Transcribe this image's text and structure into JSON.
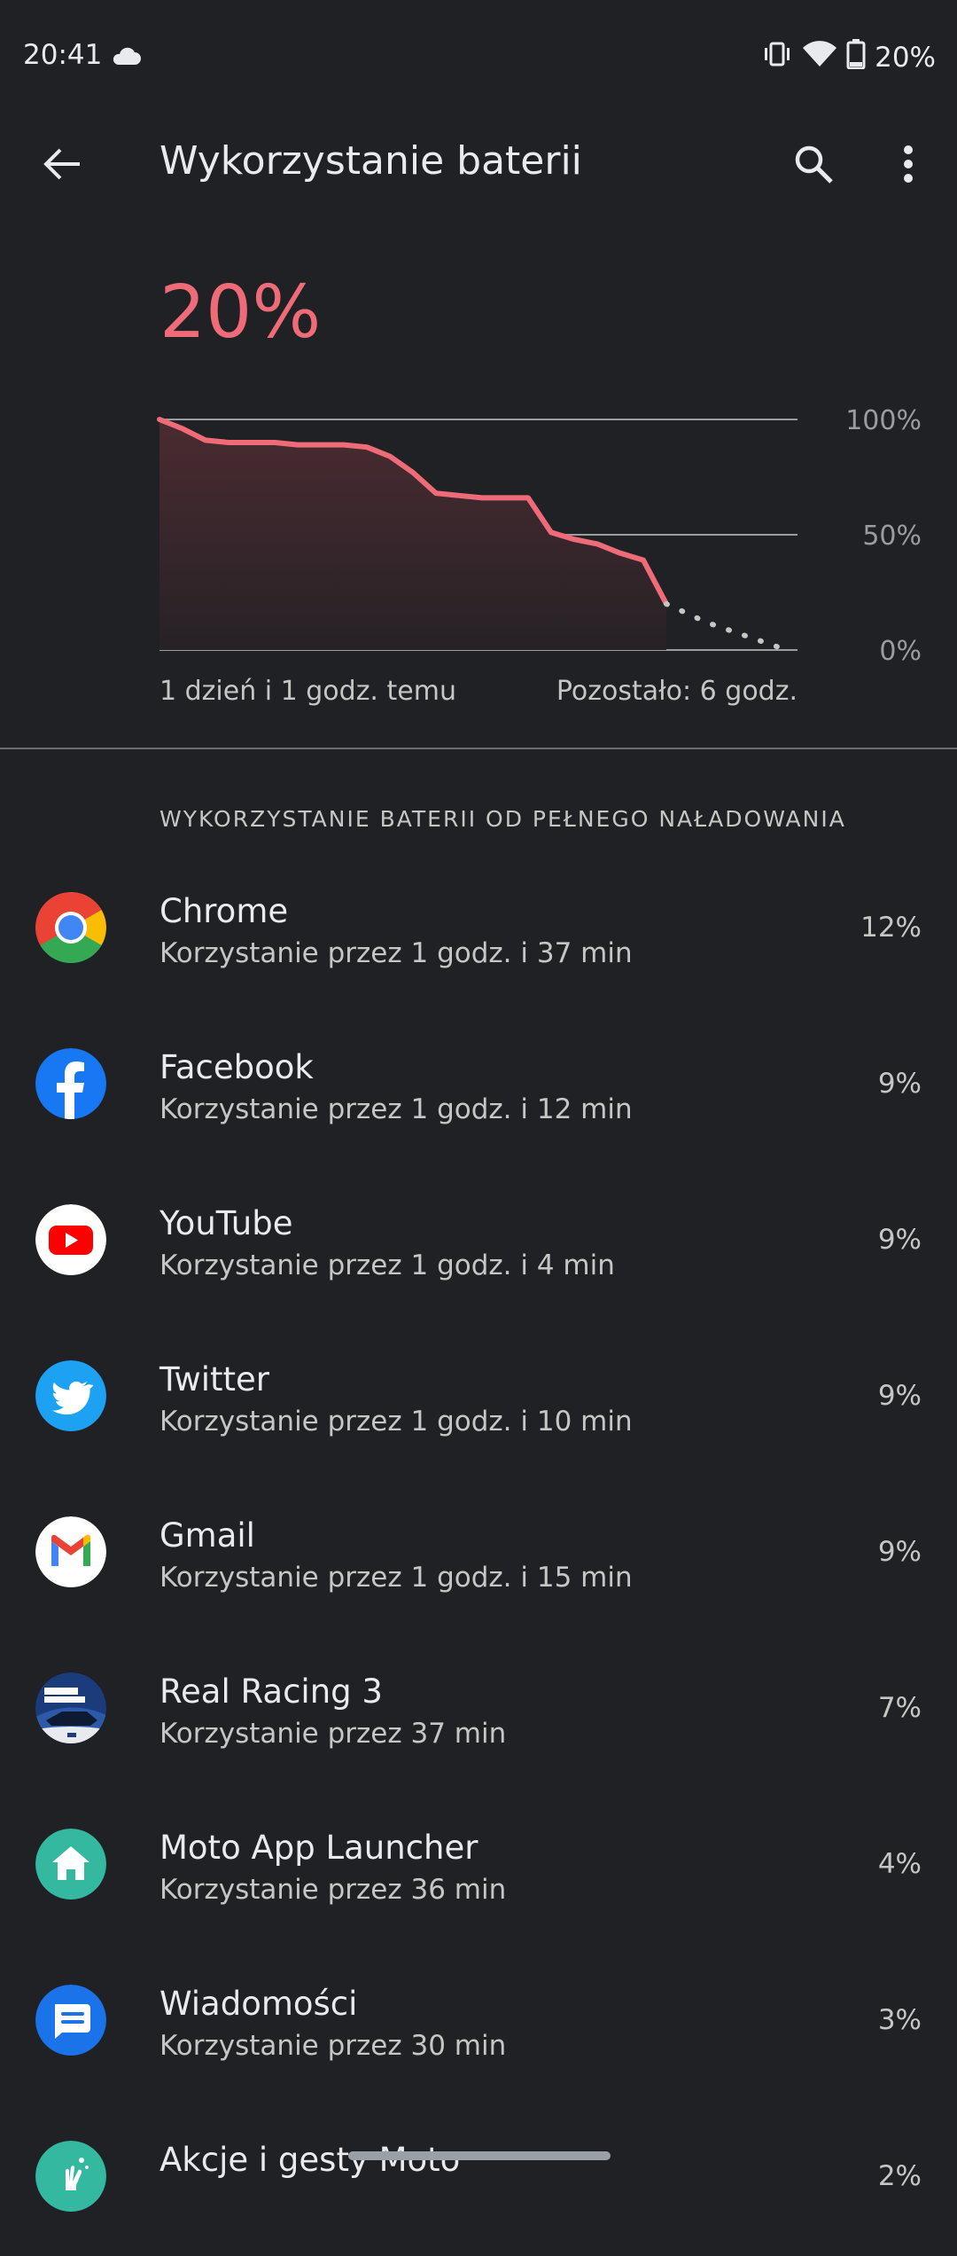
{
  "status_bar": {
    "time": "20:41",
    "battery_pct": "20%"
  },
  "app_bar": {
    "title": "Wykorzystanie baterii"
  },
  "summary": {
    "current_pct": "20%",
    "chart_left_label": "1 dzień i 1 godz. temu",
    "chart_right_label": "Pozostało: 6 godz.",
    "chart_accent": "#f06b78"
  },
  "chart_data": {
    "type": "area",
    "y_ticks": [
      "100%",
      "50%",
      "0%"
    ],
    "ylim": [
      0,
      100
    ],
    "history": [
      100,
      96,
      91,
      90,
      90,
      90,
      89,
      89,
      89,
      88,
      84,
      77,
      68,
      67,
      66,
      66,
      66,
      51,
      48,
      46,
      42,
      39,
      20
    ],
    "projection": [
      20,
      12,
      6,
      0
    ]
  },
  "section": {
    "title": "WYKORZYSTANIE BATERII OD PEŁNEGO NAŁADOWANIA"
  },
  "apps": [
    {
      "name": "Chrome",
      "usage": "Korzystanie przez 1 godz. i 37 min",
      "pct": "12%",
      "icon": "chrome-icon"
    },
    {
      "name": "Facebook",
      "usage": "Korzystanie przez 1 godz. i 12 min",
      "pct": "9%",
      "icon": "facebook-icon"
    },
    {
      "name": "YouTube",
      "usage": "Korzystanie przez 1 godz. i 4 min",
      "pct": "9%",
      "icon": "youtube-icon"
    },
    {
      "name": "Twitter",
      "usage": "Korzystanie przez 1 godz. i 10 min",
      "pct": "9%",
      "icon": "twitter-icon"
    },
    {
      "name": "Gmail",
      "usage": "Korzystanie przez 1 godz. i 15 min",
      "pct": "9%",
      "icon": "gmail-icon"
    },
    {
      "name": "Real Racing 3",
      "usage": "Korzystanie przez 37 min",
      "pct": "7%",
      "icon": "real-racing-icon"
    },
    {
      "name": "Moto App Launcher",
      "usage": "Korzystanie przez 36 min",
      "pct": "4%",
      "icon": "home-icon"
    },
    {
      "name": "Wiadomości",
      "usage": "Korzystanie przez 30 min",
      "pct": "3%",
      "icon": "messages-icon"
    },
    {
      "name": "Akcje i gesty Moto",
      "usage": "",
      "pct": "2%",
      "icon": "moto-actions-icon"
    }
  ]
}
